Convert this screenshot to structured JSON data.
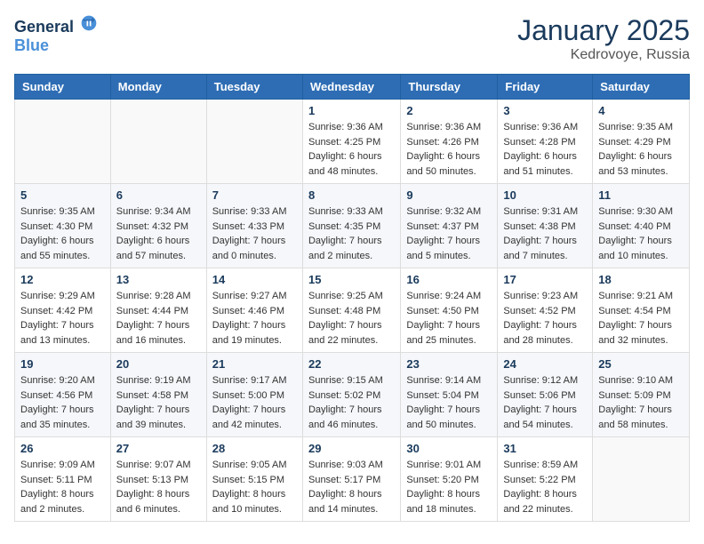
{
  "logo": {
    "text_general": "General",
    "text_blue": "Blue"
  },
  "header": {
    "month_year": "January 2025",
    "location": "Kedrovoye, Russia"
  },
  "weekdays": [
    "Sunday",
    "Monday",
    "Tuesday",
    "Wednesday",
    "Thursday",
    "Friday",
    "Saturday"
  ],
  "weeks": [
    [
      {
        "day": "",
        "sunrise": "",
        "sunset": "",
        "daylight": ""
      },
      {
        "day": "",
        "sunrise": "",
        "sunset": "",
        "daylight": ""
      },
      {
        "day": "",
        "sunrise": "",
        "sunset": "",
        "daylight": ""
      },
      {
        "day": "1",
        "sunrise": "Sunrise: 9:36 AM",
        "sunset": "Sunset: 4:25 PM",
        "daylight": "Daylight: 6 hours and 48 minutes."
      },
      {
        "day": "2",
        "sunrise": "Sunrise: 9:36 AM",
        "sunset": "Sunset: 4:26 PM",
        "daylight": "Daylight: 6 hours and 50 minutes."
      },
      {
        "day": "3",
        "sunrise": "Sunrise: 9:36 AM",
        "sunset": "Sunset: 4:28 PM",
        "daylight": "Daylight: 6 hours and 51 minutes."
      },
      {
        "day": "4",
        "sunrise": "Sunrise: 9:35 AM",
        "sunset": "Sunset: 4:29 PM",
        "daylight": "Daylight: 6 hours and 53 minutes."
      }
    ],
    [
      {
        "day": "5",
        "sunrise": "Sunrise: 9:35 AM",
        "sunset": "Sunset: 4:30 PM",
        "daylight": "Daylight: 6 hours and 55 minutes."
      },
      {
        "day": "6",
        "sunrise": "Sunrise: 9:34 AM",
        "sunset": "Sunset: 4:32 PM",
        "daylight": "Daylight: 6 hours and 57 minutes."
      },
      {
        "day": "7",
        "sunrise": "Sunrise: 9:33 AM",
        "sunset": "Sunset: 4:33 PM",
        "daylight": "Daylight: 7 hours and 0 minutes."
      },
      {
        "day": "8",
        "sunrise": "Sunrise: 9:33 AM",
        "sunset": "Sunset: 4:35 PM",
        "daylight": "Daylight: 7 hours and 2 minutes."
      },
      {
        "day": "9",
        "sunrise": "Sunrise: 9:32 AM",
        "sunset": "Sunset: 4:37 PM",
        "daylight": "Daylight: 7 hours and 5 minutes."
      },
      {
        "day": "10",
        "sunrise": "Sunrise: 9:31 AM",
        "sunset": "Sunset: 4:38 PM",
        "daylight": "Daylight: 7 hours and 7 minutes."
      },
      {
        "day": "11",
        "sunrise": "Sunrise: 9:30 AM",
        "sunset": "Sunset: 4:40 PM",
        "daylight": "Daylight: 7 hours and 10 minutes."
      }
    ],
    [
      {
        "day": "12",
        "sunrise": "Sunrise: 9:29 AM",
        "sunset": "Sunset: 4:42 PM",
        "daylight": "Daylight: 7 hours and 13 minutes."
      },
      {
        "day": "13",
        "sunrise": "Sunrise: 9:28 AM",
        "sunset": "Sunset: 4:44 PM",
        "daylight": "Daylight: 7 hours and 16 minutes."
      },
      {
        "day": "14",
        "sunrise": "Sunrise: 9:27 AM",
        "sunset": "Sunset: 4:46 PM",
        "daylight": "Daylight: 7 hours and 19 minutes."
      },
      {
        "day": "15",
        "sunrise": "Sunrise: 9:25 AM",
        "sunset": "Sunset: 4:48 PM",
        "daylight": "Daylight: 7 hours and 22 minutes."
      },
      {
        "day": "16",
        "sunrise": "Sunrise: 9:24 AM",
        "sunset": "Sunset: 4:50 PM",
        "daylight": "Daylight: 7 hours and 25 minutes."
      },
      {
        "day": "17",
        "sunrise": "Sunrise: 9:23 AM",
        "sunset": "Sunset: 4:52 PM",
        "daylight": "Daylight: 7 hours and 28 minutes."
      },
      {
        "day": "18",
        "sunrise": "Sunrise: 9:21 AM",
        "sunset": "Sunset: 4:54 PM",
        "daylight": "Daylight: 7 hours and 32 minutes."
      }
    ],
    [
      {
        "day": "19",
        "sunrise": "Sunrise: 9:20 AM",
        "sunset": "Sunset: 4:56 PM",
        "daylight": "Daylight: 7 hours and 35 minutes."
      },
      {
        "day": "20",
        "sunrise": "Sunrise: 9:19 AM",
        "sunset": "Sunset: 4:58 PM",
        "daylight": "Daylight: 7 hours and 39 minutes."
      },
      {
        "day": "21",
        "sunrise": "Sunrise: 9:17 AM",
        "sunset": "Sunset: 5:00 PM",
        "daylight": "Daylight: 7 hours and 42 minutes."
      },
      {
        "day": "22",
        "sunrise": "Sunrise: 9:15 AM",
        "sunset": "Sunset: 5:02 PM",
        "daylight": "Daylight: 7 hours and 46 minutes."
      },
      {
        "day": "23",
        "sunrise": "Sunrise: 9:14 AM",
        "sunset": "Sunset: 5:04 PM",
        "daylight": "Daylight: 7 hours and 50 minutes."
      },
      {
        "day": "24",
        "sunrise": "Sunrise: 9:12 AM",
        "sunset": "Sunset: 5:06 PM",
        "daylight": "Daylight: 7 hours and 54 minutes."
      },
      {
        "day": "25",
        "sunrise": "Sunrise: 9:10 AM",
        "sunset": "Sunset: 5:09 PM",
        "daylight": "Daylight: 7 hours and 58 minutes."
      }
    ],
    [
      {
        "day": "26",
        "sunrise": "Sunrise: 9:09 AM",
        "sunset": "Sunset: 5:11 PM",
        "daylight": "Daylight: 8 hours and 2 minutes."
      },
      {
        "day": "27",
        "sunrise": "Sunrise: 9:07 AM",
        "sunset": "Sunset: 5:13 PM",
        "daylight": "Daylight: 8 hours and 6 minutes."
      },
      {
        "day": "28",
        "sunrise": "Sunrise: 9:05 AM",
        "sunset": "Sunset: 5:15 PM",
        "daylight": "Daylight: 8 hours and 10 minutes."
      },
      {
        "day": "29",
        "sunrise": "Sunrise: 9:03 AM",
        "sunset": "Sunset: 5:17 PM",
        "daylight": "Daylight: 8 hours and 14 minutes."
      },
      {
        "day": "30",
        "sunrise": "Sunrise: 9:01 AM",
        "sunset": "Sunset: 5:20 PM",
        "daylight": "Daylight: 8 hours and 18 minutes."
      },
      {
        "day": "31",
        "sunrise": "Sunrise: 8:59 AM",
        "sunset": "Sunset: 5:22 PM",
        "daylight": "Daylight: 8 hours and 22 minutes."
      },
      {
        "day": "",
        "sunrise": "",
        "sunset": "",
        "daylight": ""
      }
    ]
  ]
}
